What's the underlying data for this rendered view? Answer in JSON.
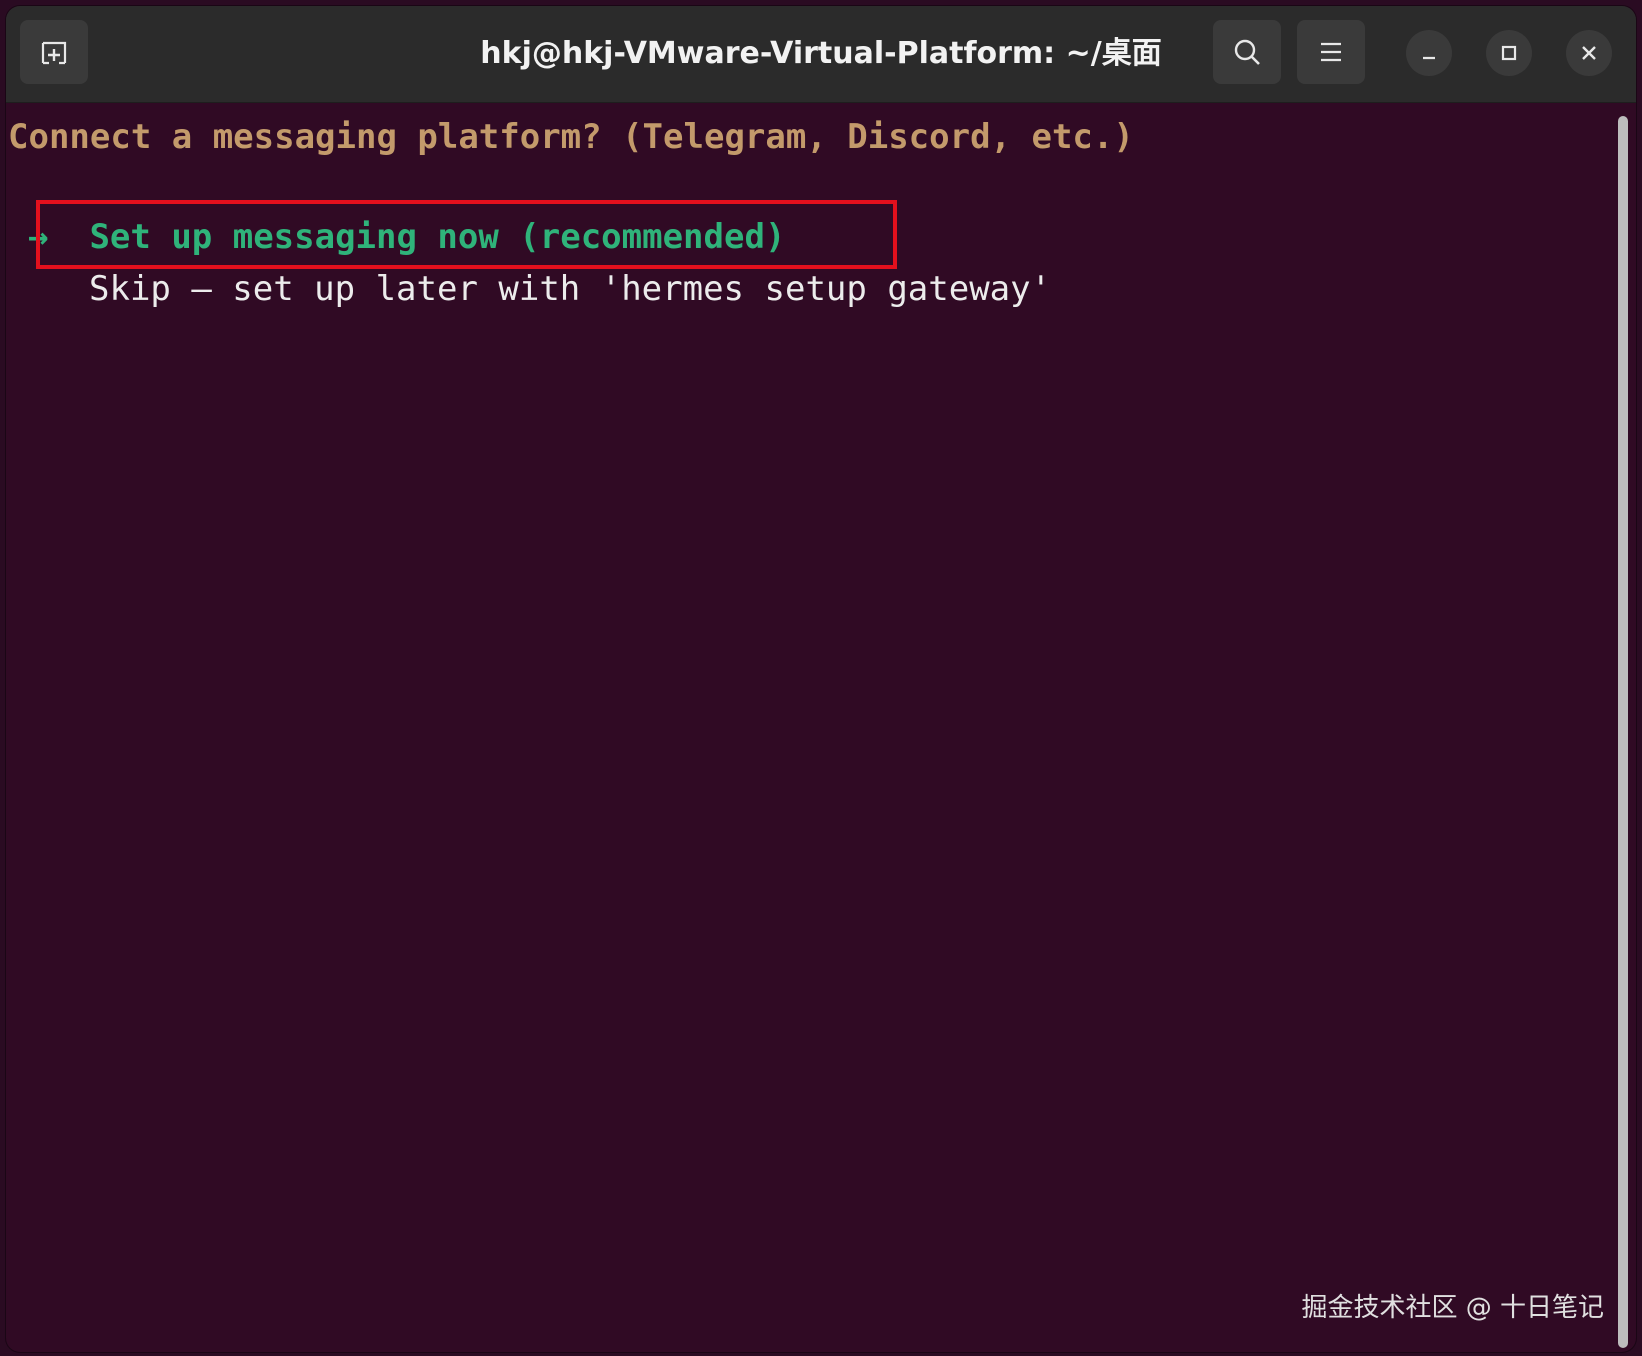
{
  "window": {
    "title": "hkj@hkj-VMware-Virtual-Platform: ~/桌面"
  },
  "toolbar": {
    "new_tab_icon": "new-tab-icon",
    "search_icon": "search-icon",
    "menu_icon": "hamburger-menu-icon",
    "minimize_icon": "minimize-icon",
    "maximize_icon": "maximize-icon",
    "close_icon": "close-icon"
  },
  "terminal": {
    "question": "Connect a messaging platform? (Telegram, Discord, etc.)",
    "options": [
      {
        "cursor": "→",
        "label": "Set up messaging now (recommended)",
        "selected": true
      },
      {
        "cursor": "",
        "label": "Skip — set up later with 'hermes setup gateway'",
        "selected": false
      }
    ]
  },
  "watermark": "掘金技术社区 @ 十日笔记",
  "colors": {
    "background": "#300a24",
    "titlebar": "#2b2b2b",
    "question_text": "#c39a6b",
    "selected_option": "#2fb37a",
    "option_text": "#ececec",
    "highlight_border": "#e3101d"
  }
}
